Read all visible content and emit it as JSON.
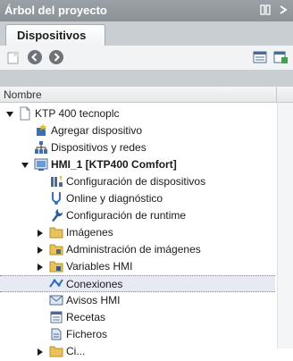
{
  "panel": {
    "title": "Árbol del proyecto"
  },
  "tabs": [
    {
      "label": "Dispositivos"
    }
  ],
  "columns": {
    "name": "Nombre"
  },
  "tree": {
    "root": "KTP 400 tecnoplc",
    "add_device": "Agregar dispositivo",
    "devices_networks": "Dispositivos y redes",
    "hmi": "HMI_1 [KTP400 Comfort]",
    "device_config": "Configuración de dispositivos",
    "online_diag": "Online y diagnóstico",
    "runtime_config": "Configuración de runtime",
    "images": "Imágenes",
    "image_admin": "Administración de imágenes",
    "hmi_variables": "Variables HMI",
    "connections": "Conexiones",
    "hmi_alarms": "Avisos HMI",
    "recipes": "Recetas",
    "files": "Ficheros",
    "partial": "Ci..."
  },
  "colors": {
    "accent": "#2a6ebb",
    "selection": "#e7eaf3"
  }
}
